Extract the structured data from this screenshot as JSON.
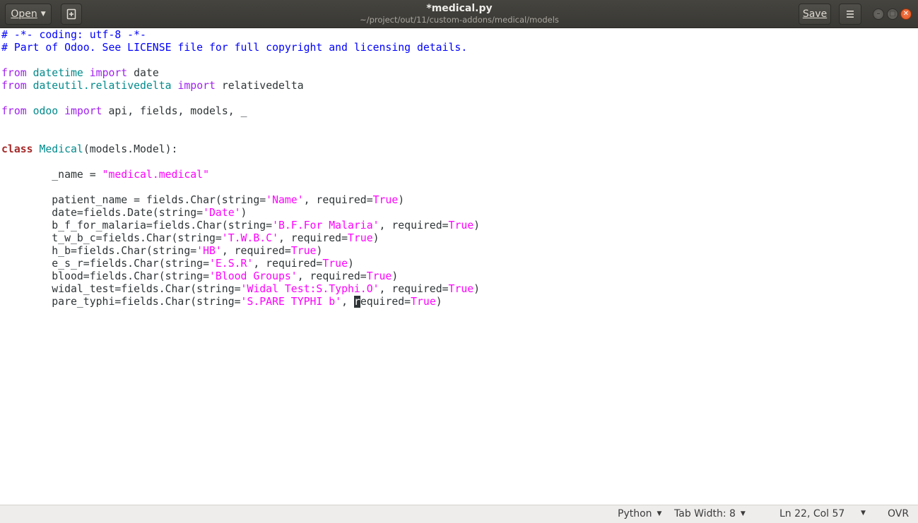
{
  "header": {
    "open_label": "Open",
    "title": "*medical.py",
    "subtitle": "~/project/out/11/custom-addons/medical/models",
    "save_label": "Save",
    "window_controls": [
      "minimize",
      "maximize",
      "close"
    ]
  },
  "editor": {
    "lines": [
      "# -*- coding: utf-8 -*-",
      "# Part of Odoo. See LICENSE file for full copyright and licensing details.",
      "",
      "from datetime import date",
      "from dateutil.relativedelta import relativedelta",
      "",
      "from odoo import api, fields, models, _",
      "",
      "",
      "class Medical(models.Model):",
      "",
      "        _name = \"medical.medical\"",
      "",
      "        patient_name = fields.Char(string='Name', required=True)",
      "        date=fields.Date(string='Date')",
      "        b_f_for_malaria=fields.Char(string='B.F.For Malaria', required=True)",
      "        t_w_b_c=fields.Char(string='T.W.B.C', required=True)",
      "        h_b=fields.Char(string='HB', required=True)",
      "        e_s_r=fields.Char(string='E.S.R', required=True)",
      "        blood=fields.Char(string='Blood Groups', required=True)",
      "        widal_test=fields.Char(string='Widal Test:S.Typhi.O', required=True)",
      "        pare_typhi=fields.Char(string='S.PARE TYPHI b', required=True)"
    ],
    "cursor": {
      "line": 22,
      "column": 57
    }
  },
  "statusbar": {
    "language": "Python",
    "tab_width": "Tab Width: 8",
    "position": "Ln 22, Col 57",
    "mode": "OVR"
  },
  "icons": {
    "new_document": "new-document-icon",
    "menu": "hamburger-menu-icon"
  },
  "colors": {
    "header_bg": "#3d3c37",
    "comment": "#0000ff",
    "keyword": "#a52a2a",
    "import": "#a020f0",
    "module": "#008a8c",
    "string": "#ff00ff",
    "close_button": "#e95420"
  }
}
